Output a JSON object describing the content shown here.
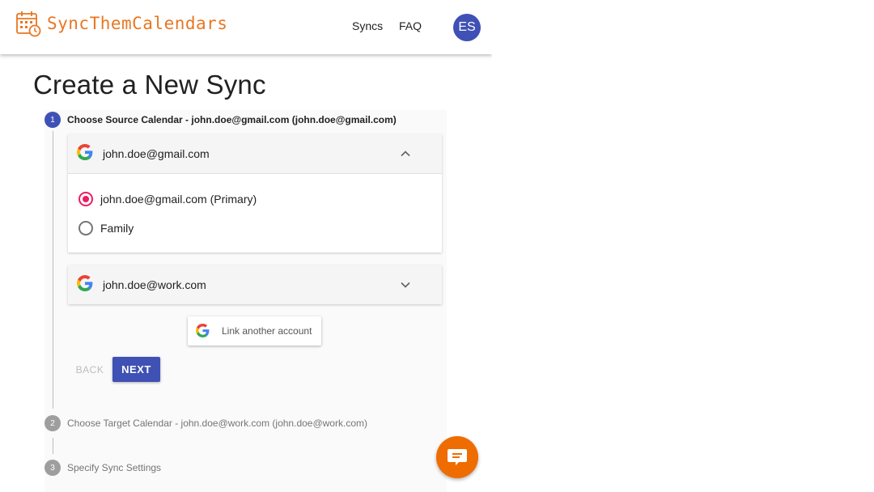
{
  "header": {
    "brand": "SyncThemCalendars",
    "nav": {
      "syncs": "Syncs",
      "faq": "FAQ"
    },
    "avatar_initials": "ES",
    "colors": {
      "brand": "#e87722",
      "primary": "#3f51b5"
    }
  },
  "page": {
    "title": "Create a New Sync"
  },
  "steps": [
    {
      "number": "1",
      "label": "Choose Source Calendar - john.doe@gmail.com (john.doe@gmail.com)",
      "state": "active"
    },
    {
      "number": "2",
      "label": "Choose Target Calendar - john.doe@work.com (john.doe@work.com)",
      "state": "inactive"
    },
    {
      "number": "3",
      "label": "Specify Sync Settings",
      "state": "inactive"
    }
  ],
  "accounts": [
    {
      "name": "john.doe@gmail.com",
      "expanded": true,
      "icon": "google-logo",
      "calendars": [
        {
          "label": "john.doe@gmail.com (Primary)",
          "selected": true
        },
        {
          "label": "Family",
          "selected": false
        }
      ]
    },
    {
      "name": "john.doe@work.com",
      "expanded": false,
      "icon": "google-logo"
    }
  ],
  "link_account_label": "Link another account",
  "buttons": {
    "back": "BACK",
    "next": "NEXT"
  },
  "chat": {
    "icon": "chat-bubble-icon",
    "color": "#ef6c00"
  },
  "radio_color": "#e91e63"
}
